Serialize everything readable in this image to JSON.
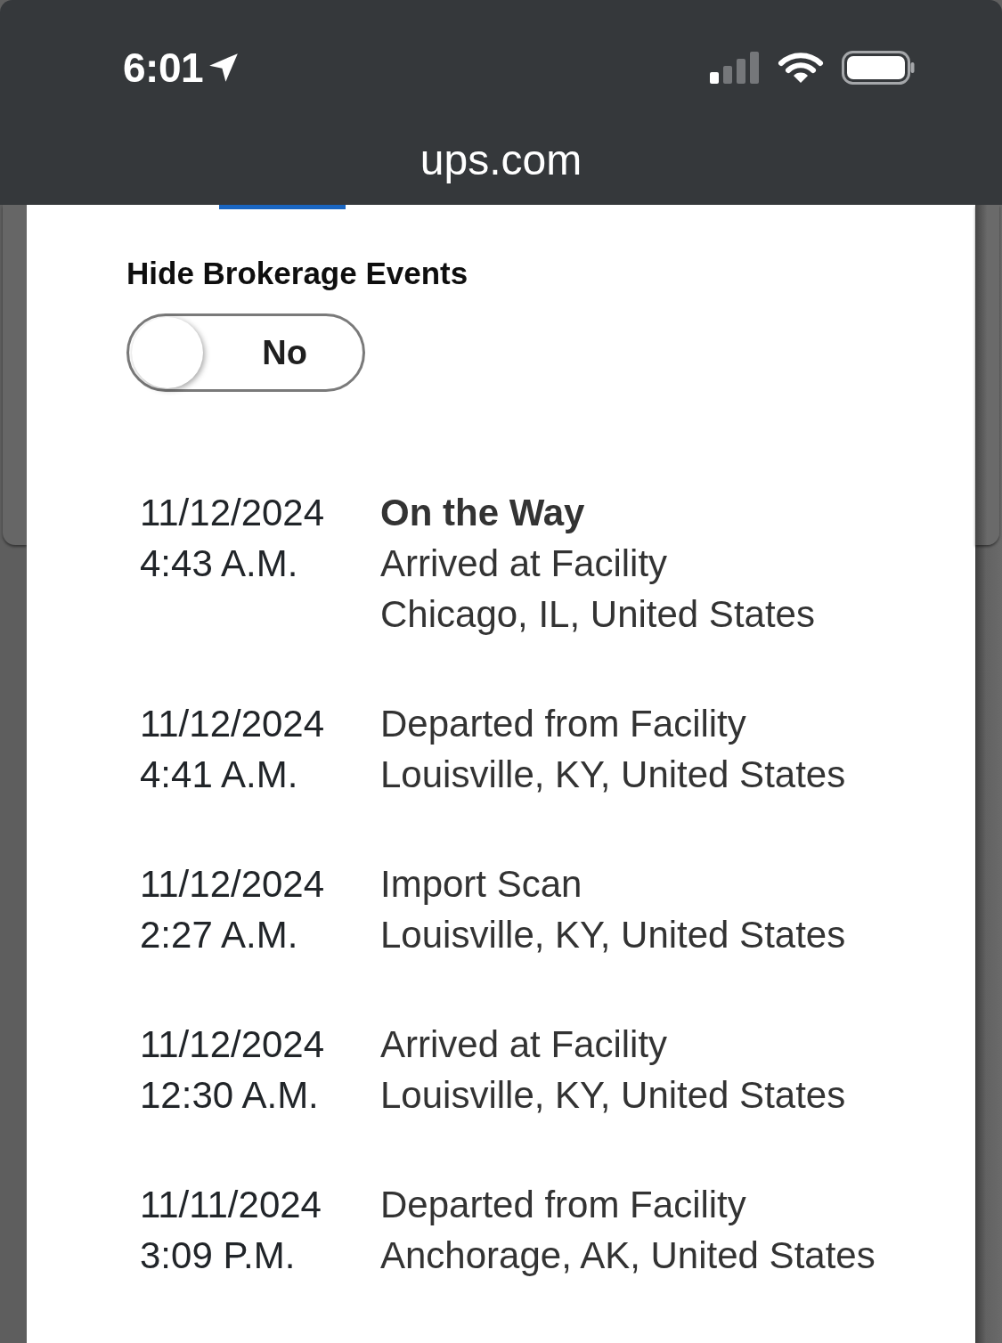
{
  "status_bar": {
    "time": "6:01"
  },
  "address_bar": {
    "url": "ups.com"
  },
  "brokerage_toggle": {
    "label": "Hide Brokerage Events",
    "on": false,
    "state_text": "No"
  },
  "events": [
    {
      "date": "11/12/2024",
      "time": "4:43 A.M.",
      "status": "On the Way",
      "activity": "Arrived at Facility",
      "location": "Chicago, IL, United States"
    },
    {
      "date": "11/12/2024",
      "time": "4:41 A.M.",
      "activity": "Departed from Facility",
      "location": "Louisville, KY, United States"
    },
    {
      "date": "11/12/2024",
      "time": "2:27 A.M.",
      "activity": "Import Scan",
      "location": "Louisville, KY, United States"
    },
    {
      "date": "11/12/2024",
      "time": "12:30 A.M.",
      "activity": "Arrived at Facility",
      "location": "Louisville, KY, United States"
    },
    {
      "date": "11/11/2024",
      "time": "3:09 P.M.",
      "activity": "Departed from Facility",
      "location": "Anchorage, AK, United States"
    }
  ]
}
